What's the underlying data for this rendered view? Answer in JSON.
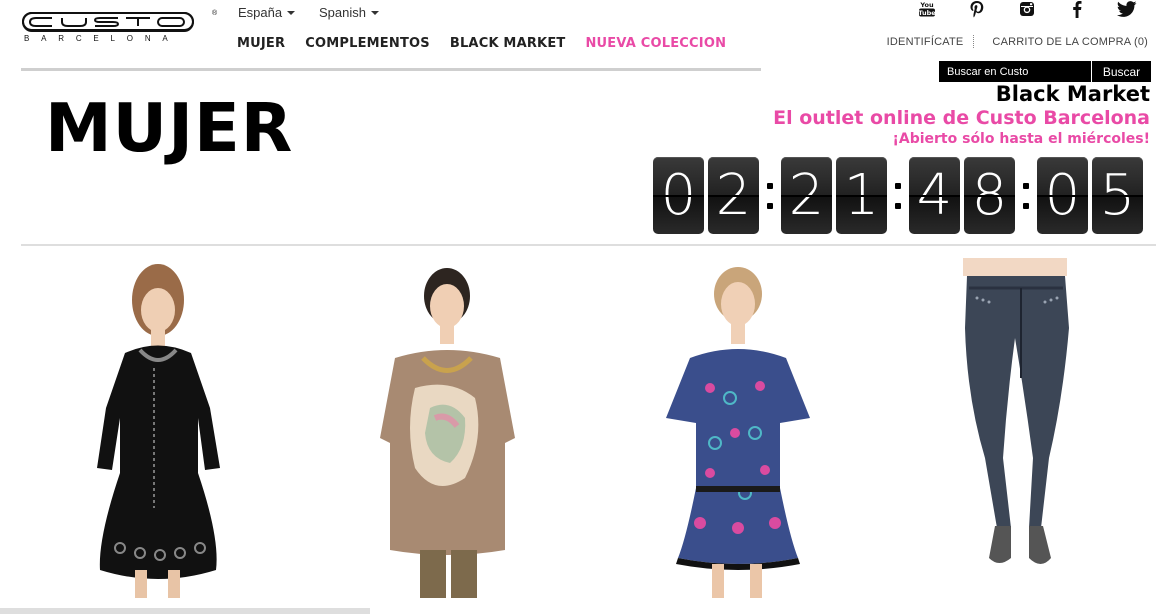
{
  "brand": {
    "name": "custo",
    "subtitle": "BARCELONA",
    "registered": "®"
  },
  "selectors": {
    "country": "España",
    "language": "Spanish"
  },
  "nav": {
    "items": [
      {
        "label": "MUJER"
      },
      {
        "label": "COMPLEMENTOS"
      },
      {
        "label": "BLACK MARKET"
      },
      {
        "label": "NUEVA COLECCION"
      }
    ],
    "highlight_color": "#e94aa6"
  },
  "social": [
    "youtube-icon",
    "pinterest-icon",
    "instagram-icon",
    "facebook-icon",
    "twitter-icon"
  ],
  "account": {
    "login": "IDENTIFÍCATE",
    "cart": "CARRITO DE LA COMPRA (0)"
  },
  "search": {
    "placeholder": "Buscar en Custo",
    "button": "Buscar"
  },
  "page": {
    "title": "MUJER"
  },
  "promo": {
    "heading": "Black Market",
    "outlet": "El outlet online de Custo Barcelona",
    "open_until": "¡Abierto sólo hasta el miércoles!",
    "accent": "#e94aa6"
  },
  "countdown": {
    "days": [
      "0",
      "2"
    ],
    "hours": [
      "2",
      "1"
    ],
    "minutes": [
      "4",
      "8"
    ],
    "seconds": [
      "0",
      "5"
    ]
  },
  "products": [
    {
      "image": "black-embroidered-dress"
    },
    {
      "image": "printed-tunic-top"
    },
    {
      "image": "patterned-blue-pink-dress"
    },
    {
      "image": "dark-denim-jeans"
    }
  ]
}
